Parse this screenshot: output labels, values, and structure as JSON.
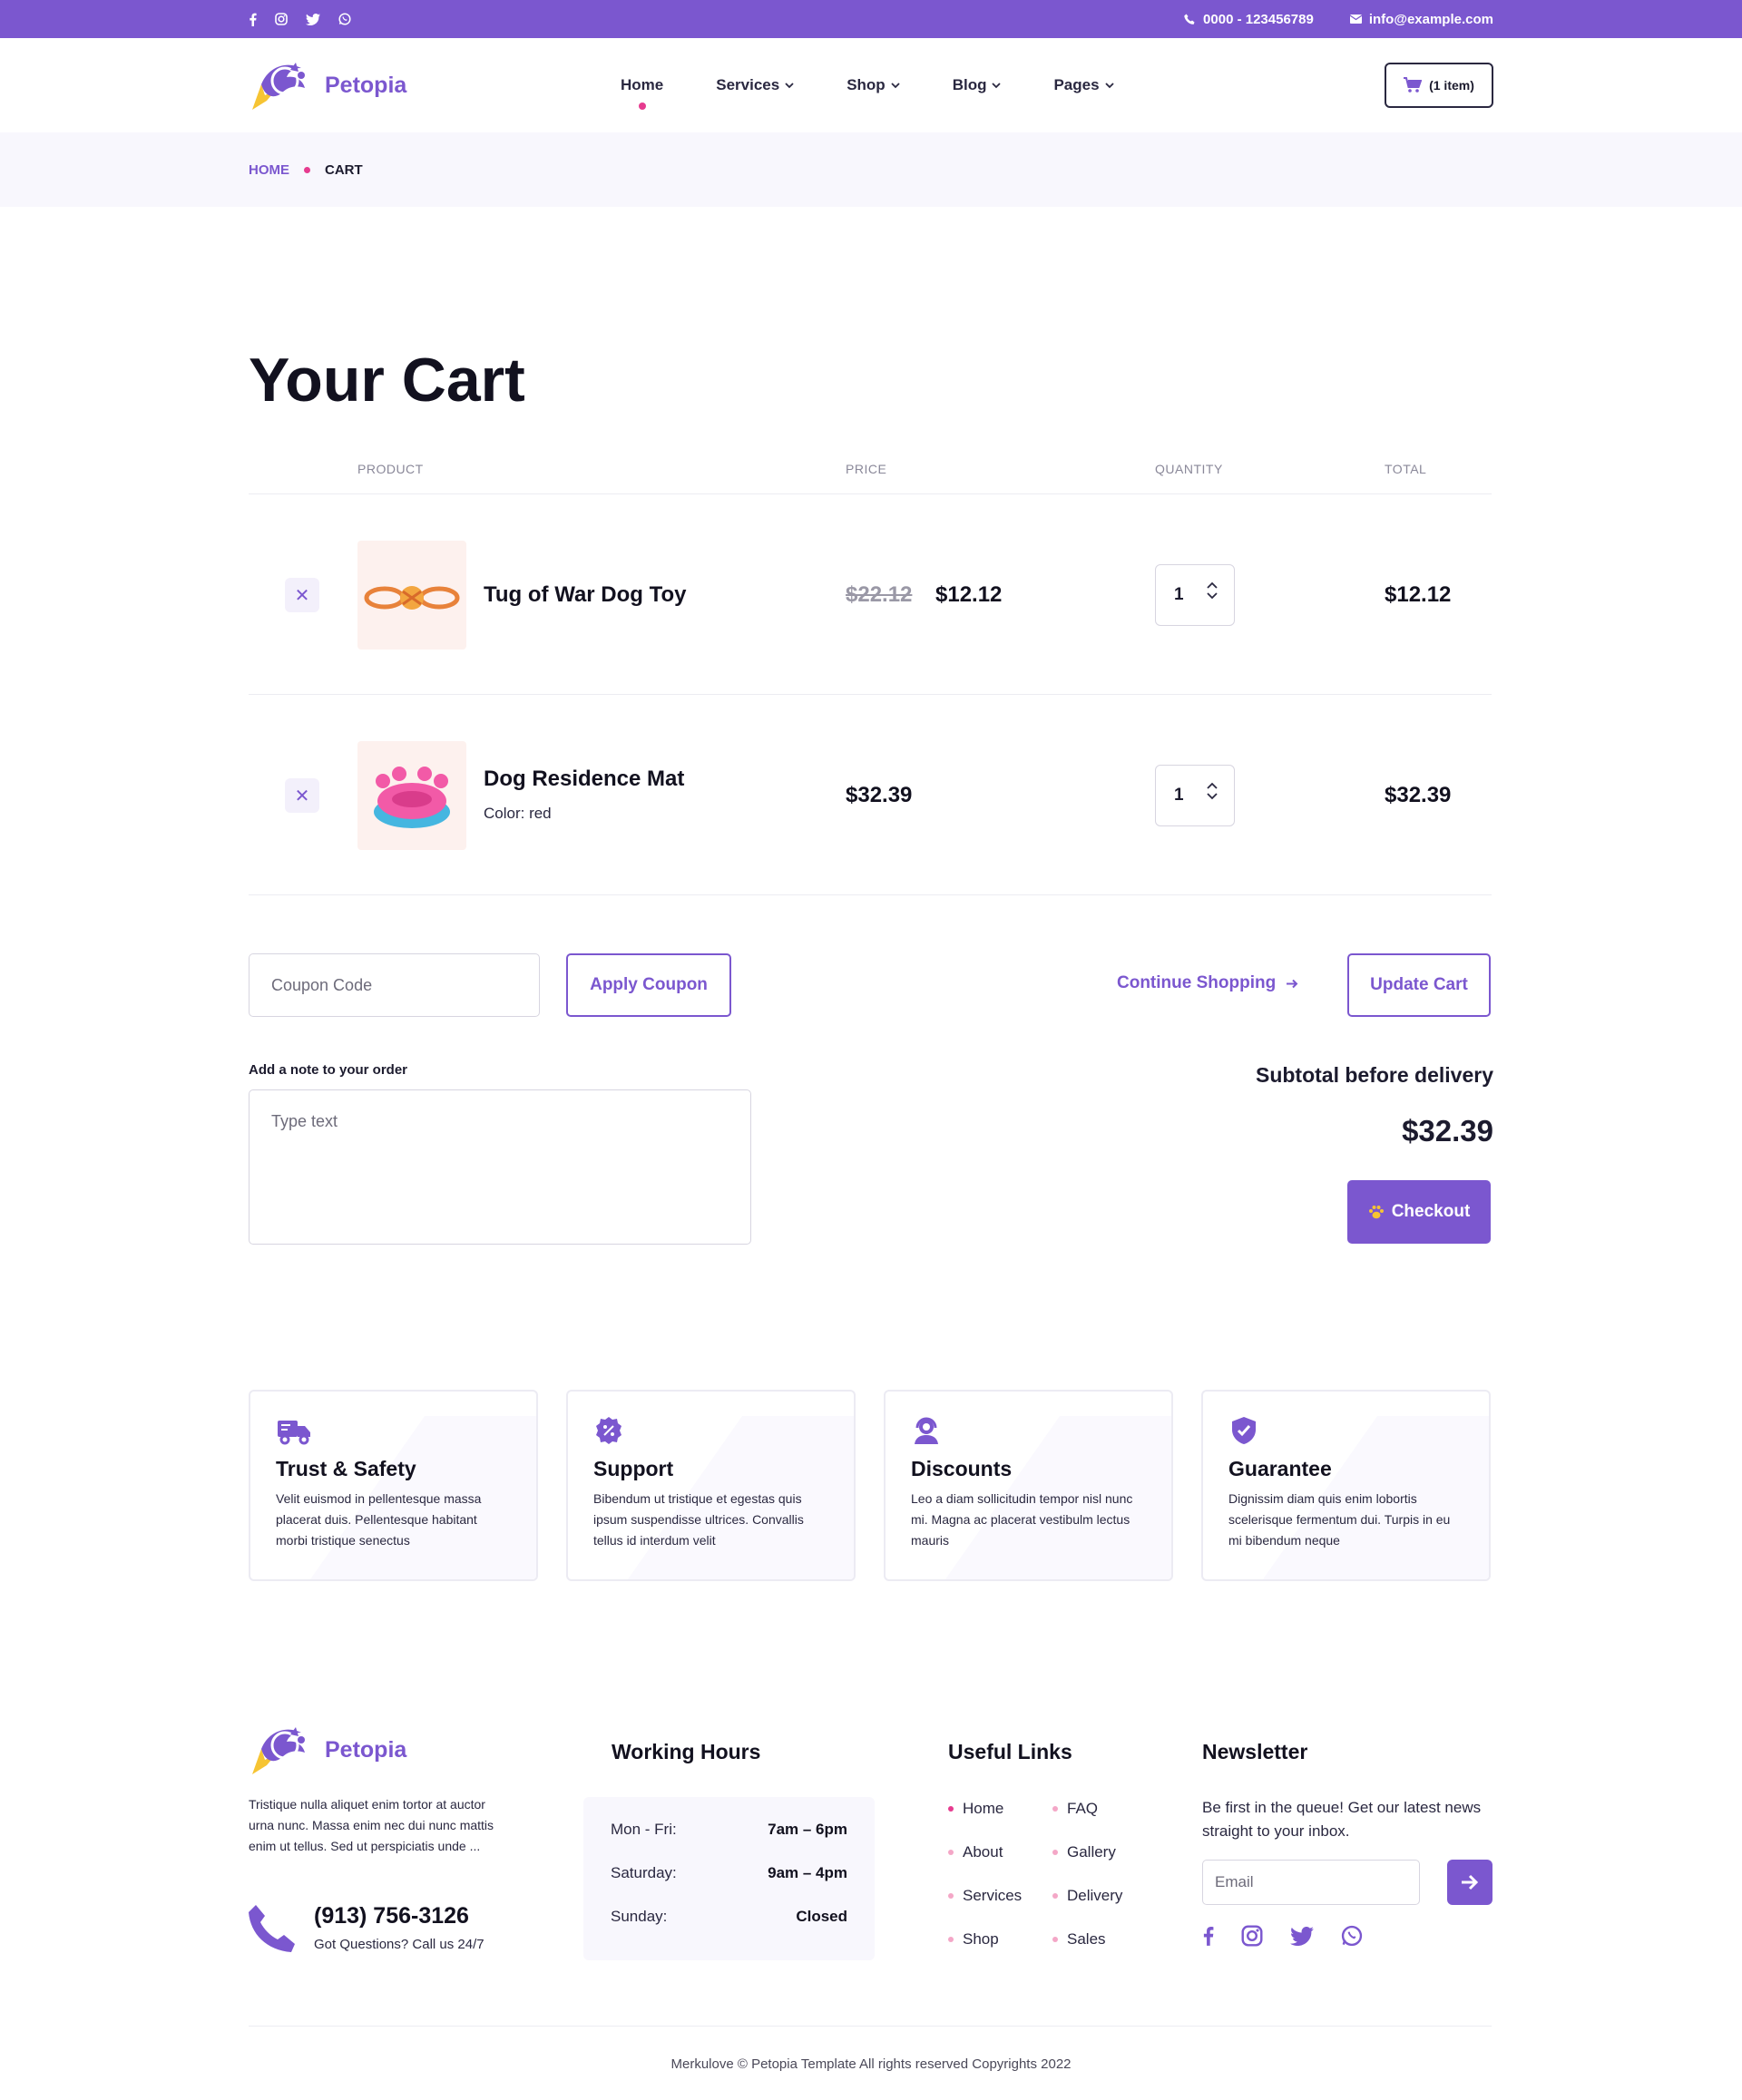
{
  "colors": {
    "accent": "#7b57cf",
    "pink": "#e63b8f",
    "dark": "#12111f"
  },
  "topbar": {
    "social_icons": [
      "facebook-icon",
      "instagram-icon",
      "twitter-icon",
      "whatsapp-icon"
    ],
    "phone": "0000 - 123456789",
    "email": "info@example.com"
  },
  "header": {
    "logo_text": "Petopia",
    "nav": [
      {
        "label": "Home",
        "active": true
      },
      {
        "label": "Services",
        "dropdown": true
      },
      {
        "label": "Shop",
        "dropdown": true
      },
      {
        "label": "Blog",
        "dropdown": true
      },
      {
        "label": "Pages",
        "dropdown": true
      }
    ],
    "cart_label": "(1 item)"
  },
  "breadcrumb": {
    "home": "HOME",
    "current": "CART"
  },
  "cart": {
    "title": "Your Cart",
    "columns": {
      "product": "PRODUCT",
      "price": "PRICE",
      "quantity": "QUANTITY",
      "total": "TOTAL"
    },
    "items": [
      {
        "name": "Tug of War Dog Toy",
        "old_price": "$22.12",
        "price": "$12.12",
        "quantity": "1",
        "total": "$12.12"
      },
      {
        "name": "Dog Residence Mat",
        "variant": "Color: red",
        "price": "$32.39",
        "quantity": "1",
        "total": "$32.39"
      }
    ],
    "coupon_placeholder": "Coupon Code",
    "apply_coupon": "Apply Coupon",
    "continue_shopping": "Continue Shopping",
    "update_cart": "Update Cart",
    "note_label": "Add a note to your order",
    "note_placeholder": "Type text",
    "subtotal_label": "Subtotal before delivery",
    "subtotal_value": "$32.39",
    "checkout": "Checkout"
  },
  "features": [
    {
      "icon": "truck-icon",
      "title": "Trust & Safety",
      "text": "Velit euismod in pellentesque massa placerat duis. Pellentesque habitant morbi tristique senectus"
    },
    {
      "icon": "discount-badge-icon",
      "title": "Support",
      "text": "Bibendum ut tristique et egestas quis ipsum suspendisse ultrices. Convallis tellus id interdum velit"
    },
    {
      "icon": "headset-icon",
      "title": "Discounts",
      "text": "Leo a diam sollicitudin tempor nisl nunc mi. Magna ac placerat vestibulm lectus mauris"
    },
    {
      "icon": "shield-check-icon",
      "title": "Guarantee",
      "text": "Dignissim diam quis enim lobortis scelerisque fermentum dui. Turpis in eu mi bibendum neque"
    }
  ],
  "footer": {
    "logo_text": "Petopia",
    "about": "Tristique nulla aliquet enim tortor at auctor urna nunc. Massa enim nec dui nunc mattis enim ut tellus. Sed ut perspiciatis unde ...",
    "phone": "(913) 756-3126",
    "phone_sub": "Got Questions? Call us 24/7",
    "hours_title": "Working Hours",
    "hours": [
      {
        "day": "Mon - Fri:",
        "time": "7am – 6pm"
      },
      {
        "day": "Saturday:",
        "time": "9am – 4pm"
      },
      {
        "day": "Sunday:",
        "time": "Closed"
      }
    ],
    "links_title": "Useful Links",
    "links": [
      "Home",
      "FAQ",
      "About",
      "Gallery",
      "Services",
      "Delivery",
      "Shop",
      "Sales"
    ],
    "newsletter_title": "Newsletter",
    "newsletter_text": "Be first in the queue! Get our latest news straight to your inbox.",
    "email_placeholder": "Email",
    "social_icons": [
      "facebook-icon",
      "instagram-icon",
      "twitter-icon",
      "whatsapp-icon"
    ],
    "copyright": "Merkulove © Petopia Template All rights reserved Copyrights 2022"
  }
}
